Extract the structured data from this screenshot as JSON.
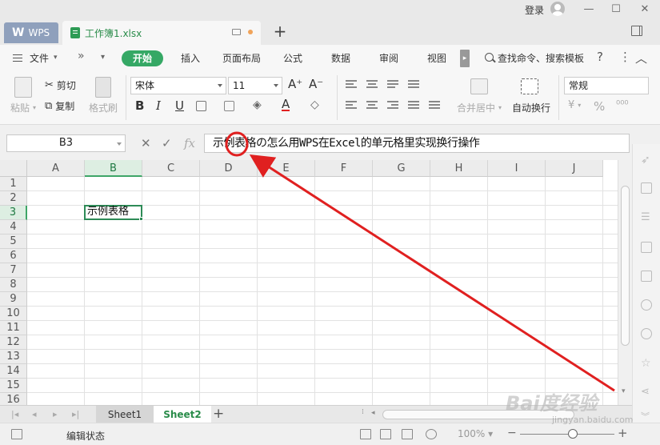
{
  "titlebar": {
    "wps_tab": "WPS",
    "file_tab": "工作簿1.xlsx",
    "new_tab": "+",
    "login": "登录",
    "minimize": "—",
    "maximize": "☐",
    "close": "✕"
  },
  "menu": {
    "file": "文件",
    "more": "»",
    "dropdown": "▾",
    "items": [
      "开始",
      "插入",
      "页面布局",
      "公式",
      "数据",
      "审阅",
      "视图"
    ],
    "scroll": "▸",
    "search": "查找命令、搜索模板",
    "help": "?",
    "more_dots": "⋮",
    "collapse": "︿"
  },
  "ribbon": {
    "paste": "粘贴",
    "cut": "剪切",
    "copy": "复制",
    "format_painter": "格式刷",
    "font_name": "宋体",
    "font_size": "11",
    "grow": "A⁺",
    "shrink": "A⁻",
    "bold": "B",
    "italic": "I",
    "underline": "U",
    "merge": "合并居中",
    "wrap": "自动换行",
    "number_format": "常规",
    "percent": "%",
    "currency": "¥",
    "thousands": "⁰⁰⁰"
  },
  "formula_bar": {
    "name_box": "B3",
    "cancel": "✕",
    "confirm": "✓",
    "fx": "fx",
    "content": "示例表格の怎么用WPS在Excel的单元格里实现换行操作"
  },
  "grid": {
    "columns": [
      "A",
      "B",
      "C",
      "D",
      "E",
      "F",
      "G",
      "H",
      "I",
      "J"
    ],
    "rows": [
      "1",
      "2",
      "3",
      "4",
      "5",
      "6",
      "7",
      "8",
      "9",
      "10",
      "11",
      "12",
      "13",
      "14",
      "15",
      "16"
    ],
    "active_column": "B",
    "active_row": "3",
    "b3_value": "示例表格"
  },
  "sheets": {
    "tabs": [
      "Sheet1",
      "Sheet2"
    ],
    "active": "Sheet2",
    "add": "+"
  },
  "status": {
    "mode": "编辑状态",
    "zoom": "100%",
    "zoom_minus": "−",
    "zoom_plus": "+"
  },
  "watermark": {
    "brand": "Bai度经验",
    "url": "jingyan.baidu.com"
  },
  "colors": {
    "accent_green": "#35a865",
    "annotation_red": "#e02020"
  }
}
